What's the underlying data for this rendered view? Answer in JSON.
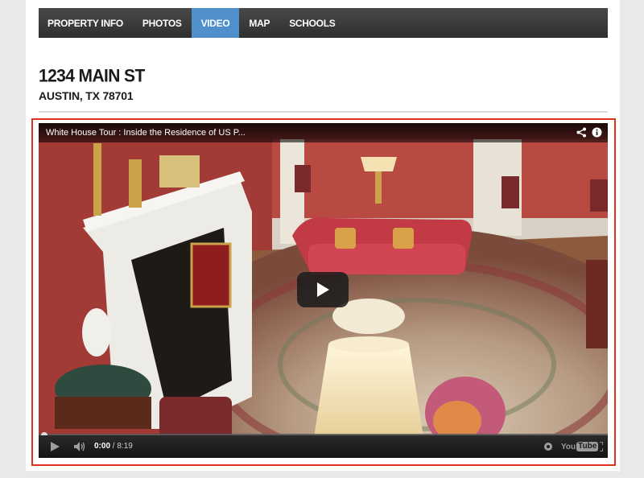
{
  "nav": {
    "items": [
      {
        "label": "PROPERTY INFO",
        "active": false
      },
      {
        "label": "PHOTOS",
        "active": false
      },
      {
        "label": "VIDEO",
        "active": true
      },
      {
        "label": "MAP",
        "active": false
      },
      {
        "label": "SCHOOLS",
        "active": false
      }
    ],
    "active_color": "#4f8fcc"
  },
  "address": {
    "street": "1234 MAIN ST",
    "city_state_zip": "AUSTIN, TX 78701"
  },
  "video": {
    "title": "White House Tour : Inside the Residence of US P...",
    "current_time": "0:00",
    "duration": "8:19",
    "separator": "/",
    "progress_fraction": 0,
    "highlight_color": "#e0301e",
    "logo_text_1": "You",
    "logo_text_2": "Tube",
    "icons": [
      "share-icon",
      "info-icon",
      "play-icon",
      "volume-icon",
      "settings-icon",
      "fullscreen-icon"
    ]
  }
}
